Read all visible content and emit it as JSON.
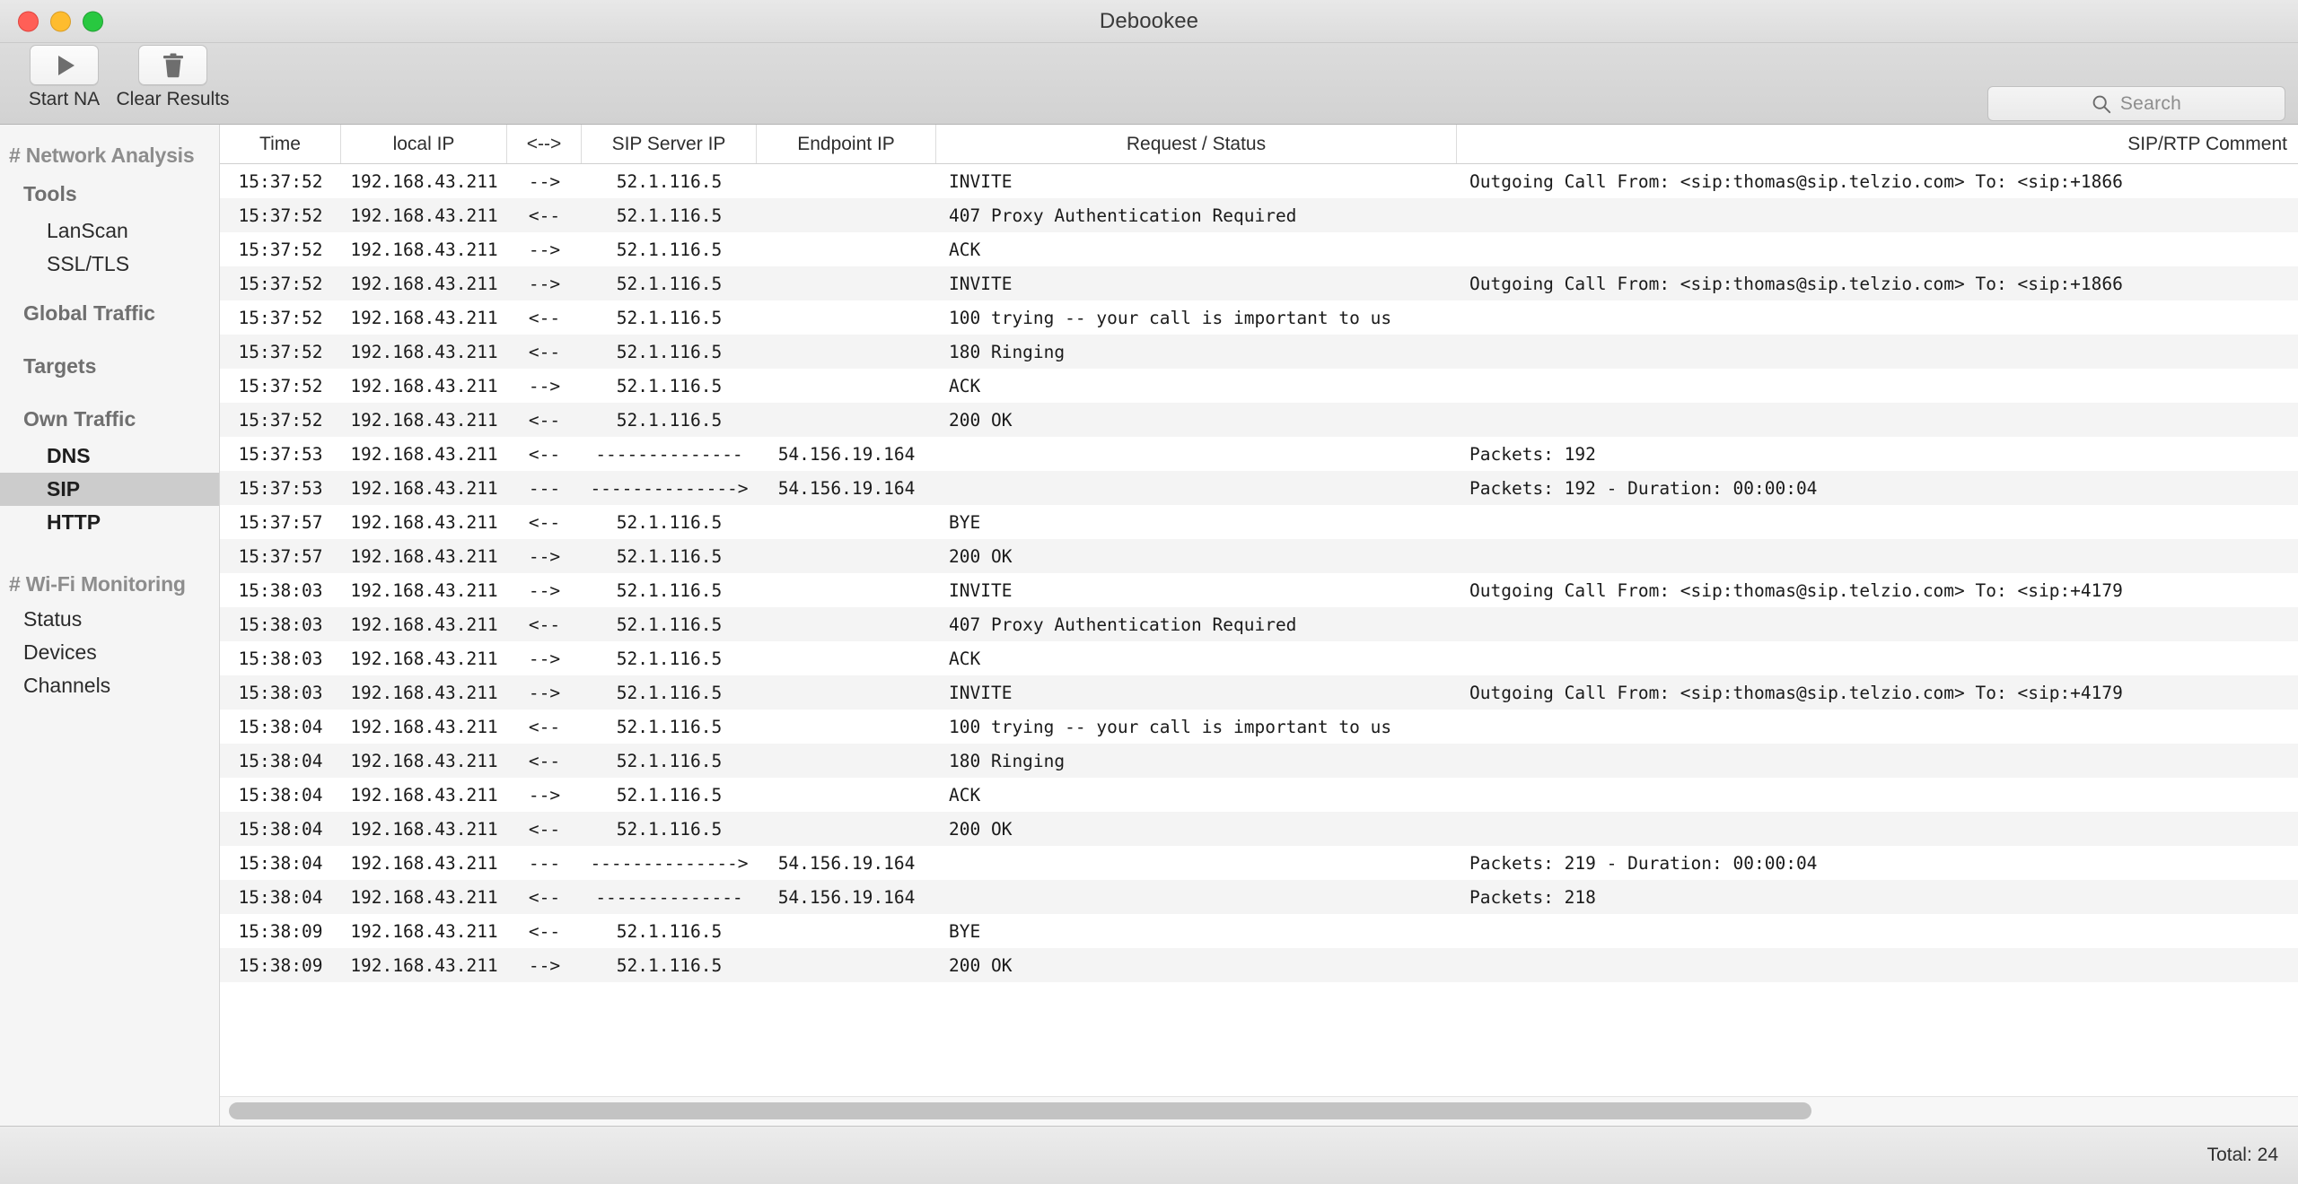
{
  "window": {
    "title": "Debookee"
  },
  "toolbar": {
    "start_label": "Start NA",
    "clear_label": "Clear Results",
    "search_placeholder": "Search"
  },
  "sidebar": {
    "groups": [
      {
        "heading": "# Network Analysis",
        "entries": [
          {
            "label": "Tools",
            "type": "section"
          },
          {
            "label": "LanScan",
            "type": "item"
          },
          {
            "label": "SSL/TLS",
            "type": "item"
          },
          {
            "label": "Global Traffic",
            "type": "section"
          },
          {
            "label": "Targets",
            "type": "section"
          },
          {
            "label": "Own Traffic",
            "type": "section"
          },
          {
            "label": "DNS",
            "type": "item-bold"
          },
          {
            "label": "SIP",
            "type": "item-bold-selected"
          },
          {
            "label": "HTTP",
            "type": "item-bold"
          }
        ]
      },
      {
        "heading": "# Wi-Fi Monitoring",
        "entries": [
          {
            "label": "Status",
            "type": "item-plain"
          },
          {
            "label": "Devices",
            "type": "item-plain"
          },
          {
            "label": "Channels",
            "type": "item-plain"
          }
        ]
      }
    ]
  },
  "table": {
    "columns": [
      {
        "key": "time",
        "label": "Time"
      },
      {
        "key": "local_ip",
        "label": "local IP"
      },
      {
        "key": "dir",
        "label": "<-->"
      },
      {
        "key": "sip_ip",
        "label": "SIP Server IP"
      },
      {
        "key": "endpoint",
        "label": "Endpoint IP"
      },
      {
        "key": "request",
        "label": "Request / Status"
      },
      {
        "key": "comment",
        "label": "SIP/RTP Comment"
      }
    ],
    "rows": [
      {
        "time": "15:37:52",
        "local_ip": "192.168.43.211",
        "dir": "-->",
        "sip_ip": "52.1.116.5",
        "endpoint": "",
        "request": "INVITE",
        "comment": "Outgoing Call From: <sip:thomas@sip.telzio.com> To: <sip:+1866"
      },
      {
        "time": "15:37:52",
        "local_ip": "192.168.43.211",
        "dir": "<--",
        "sip_ip": "52.1.116.5",
        "endpoint": "",
        "request": "407 Proxy Authentication Required",
        "comment": ""
      },
      {
        "time": "15:37:52",
        "local_ip": "192.168.43.211",
        "dir": "-->",
        "sip_ip": "52.1.116.5",
        "endpoint": "",
        "request": "ACK",
        "comment": ""
      },
      {
        "time": "15:37:52",
        "local_ip": "192.168.43.211",
        "dir": "-->",
        "sip_ip": "52.1.116.5",
        "endpoint": "",
        "request": "INVITE",
        "comment": "Outgoing Call From: <sip:thomas@sip.telzio.com> To: <sip:+1866"
      },
      {
        "time": "15:37:52",
        "local_ip": "192.168.43.211",
        "dir": "<--",
        "sip_ip": "52.1.116.5",
        "endpoint": "",
        "request": "100 trying -- your call is important to us",
        "comment": ""
      },
      {
        "time": "15:37:52",
        "local_ip": "192.168.43.211",
        "dir": "<--",
        "sip_ip": "52.1.116.5",
        "endpoint": "",
        "request": "180 Ringing",
        "comment": ""
      },
      {
        "time": "15:37:52",
        "local_ip": "192.168.43.211",
        "dir": "-->",
        "sip_ip": "52.1.116.5",
        "endpoint": "",
        "request": "ACK",
        "comment": ""
      },
      {
        "time": "15:37:52",
        "local_ip": "192.168.43.211",
        "dir": "<--",
        "sip_ip": "52.1.116.5",
        "endpoint": "",
        "request": "200 OK",
        "comment": ""
      },
      {
        "time": "15:37:53",
        "local_ip": "192.168.43.211",
        "dir": "<--",
        "sip_ip": "--------------",
        "endpoint": "54.156.19.164",
        "request": "",
        "comment": "Packets: 192"
      },
      {
        "time": "15:37:53",
        "local_ip": "192.168.43.211",
        "dir": "---",
        "sip_ip": "-------------->",
        "endpoint": "54.156.19.164",
        "request": "",
        "comment": "Packets: 192 - Duration: 00:00:04"
      },
      {
        "time": "15:37:57",
        "local_ip": "192.168.43.211",
        "dir": "<--",
        "sip_ip": "52.1.116.5",
        "endpoint": "",
        "request": "BYE",
        "comment": ""
      },
      {
        "time": "15:37:57",
        "local_ip": "192.168.43.211",
        "dir": "-->",
        "sip_ip": "52.1.116.5",
        "endpoint": "",
        "request": "200 OK",
        "comment": ""
      },
      {
        "time": "15:38:03",
        "local_ip": "192.168.43.211",
        "dir": "-->",
        "sip_ip": "52.1.116.5",
        "endpoint": "",
        "request": "INVITE",
        "comment": "Outgoing Call From: <sip:thomas@sip.telzio.com> To: <sip:+4179"
      },
      {
        "time": "15:38:03",
        "local_ip": "192.168.43.211",
        "dir": "<--",
        "sip_ip": "52.1.116.5",
        "endpoint": "",
        "request": "407 Proxy Authentication Required",
        "comment": ""
      },
      {
        "time": "15:38:03",
        "local_ip": "192.168.43.211",
        "dir": "-->",
        "sip_ip": "52.1.116.5",
        "endpoint": "",
        "request": "ACK",
        "comment": ""
      },
      {
        "time": "15:38:03",
        "local_ip": "192.168.43.211",
        "dir": "-->",
        "sip_ip": "52.1.116.5",
        "endpoint": "",
        "request": "INVITE",
        "comment": "Outgoing Call From: <sip:thomas@sip.telzio.com> To: <sip:+4179"
      },
      {
        "time": "15:38:04",
        "local_ip": "192.168.43.211",
        "dir": "<--",
        "sip_ip": "52.1.116.5",
        "endpoint": "",
        "request": "100 trying -- your call is important to us",
        "comment": ""
      },
      {
        "time": "15:38:04",
        "local_ip": "192.168.43.211",
        "dir": "<--",
        "sip_ip": "52.1.116.5",
        "endpoint": "",
        "request": "180 Ringing",
        "comment": ""
      },
      {
        "time": "15:38:04",
        "local_ip": "192.168.43.211",
        "dir": "-->",
        "sip_ip": "52.1.116.5",
        "endpoint": "",
        "request": "ACK",
        "comment": ""
      },
      {
        "time": "15:38:04",
        "local_ip": "192.168.43.211",
        "dir": "<--",
        "sip_ip": "52.1.116.5",
        "endpoint": "",
        "request": "200 OK",
        "comment": ""
      },
      {
        "time": "15:38:04",
        "local_ip": "192.168.43.211",
        "dir": "---",
        "sip_ip": "-------------->",
        "endpoint": "54.156.19.164",
        "request": "",
        "comment": "Packets: 219 - Duration: 00:00:04"
      },
      {
        "time": "15:38:04",
        "local_ip": "192.168.43.211",
        "dir": "<--",
        "sip_ip": "--------------",
        "endpoint": "54.156.19.164",
        "request": "",
        "comment": "Packets: 218"
      },
      {
        "time": "15:38:09",
        "local_ip": "192.168.43.211",
        "dir": "<--",
        "sip_ip": "52.1.116.5",
        "endpoint": "",
        "request": "BYE",
        "comment": ""
      },
      {
        "time": "15:38:09",
        "local_ip": "192.168.43.211",
        "dir": "-->",
        "sip_ip": "52.1.116.5",
        "endpoint": "",
        "request": "200 OK",
        "comment": ""
      }
    ]
  },
  "statusbar": {
    "total_label": "Total: 24"
  },
  "colors": {
    "selected_row": "#cccccc",
    "alt_row": "#f4f4f4",
    "sidebar_bg": "#f5f5f5",
    "accent_close": "#ff5f57",
    "accent_min": "#febc2e",
    "accent_max": "#28c840"
  },
  "icons": {
    "play": "play-icon",
    "trash": "trash-icon",
    "search": "search-icon"
  }
}
